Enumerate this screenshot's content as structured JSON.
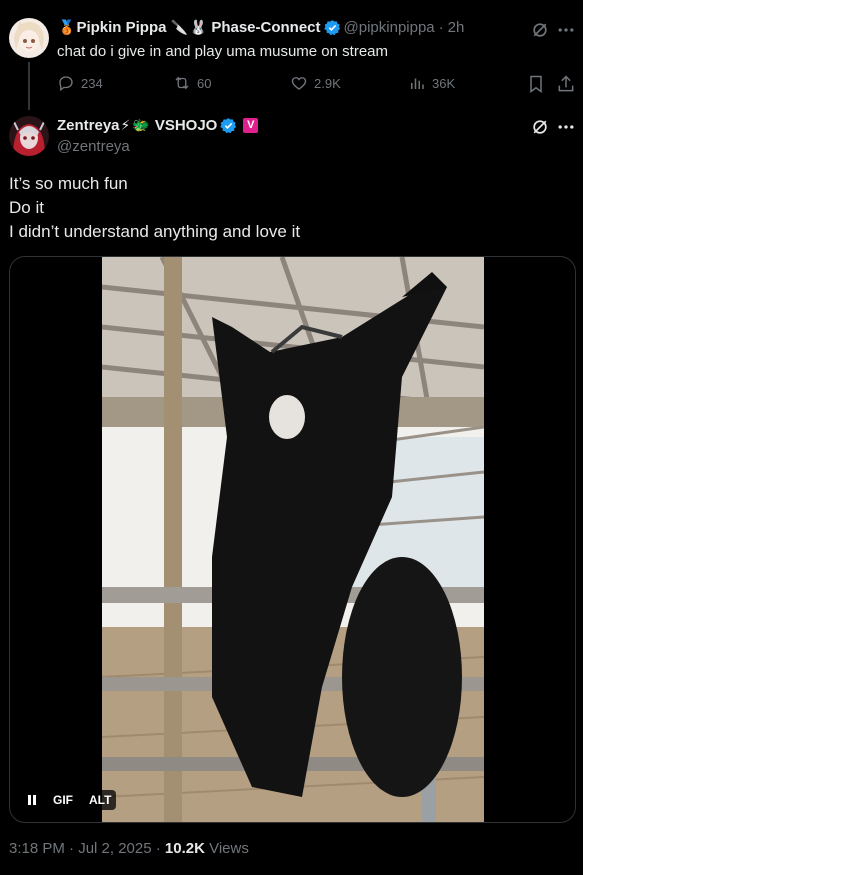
{
  "original_tweet": {
    "display_name": "Pipkin Pippa",
    "name_emojis": [
      "🥉",
      "🔪",
      "🐰"
    ],
    "affiliation": "Phase-Connect",
    "handle": "@pipkinpippa",
    "separator": "·",
    "time": "2h",
    "text": "chat do i give in and play uma musume on stream",
    "actions": {
      "replies": "234",
      "reposts": "60",
      "likes": "2.9K",
      "views": "36K"
    }
  },
  "reply_tweet": {
    "display_name": "Zentreya",
    "name_emojis": [
      "⚡",
      "🐲"
    ],
    "affiliation": "VSHOJO",
    "affiliation_badge": "V",
    "handle": "@zentreya",
    "lines": [
      "It’s so much fun",
      "Do it",
      "I didn’t understand anything and love it"
    ],
    "media": {
      "gif_label": "GIF",
      "alt_label": "ALT"
    },
    "timestamp": "3:18 PM · Jul 2, 2025 · ",
    "views_count": "10.2K",
    "views_label": " Views"
  },
  "colors": {
    "background": "#000000",
    "text": "#e7e9ea",
    "muted": "#71767b",
    "verified": "#1d9bf0",
    "vshojo_badge": "#e0208f"
  },
  "icons": [
    "grok-icon",
    "more-icon",
    "reply-icon",
    "repost-icon",
    "like-icon",
    "views-icon",
    "bookmark-icon",
    "share-icon",
    "verified-icon",
    "pause-icon"
  ]
}
